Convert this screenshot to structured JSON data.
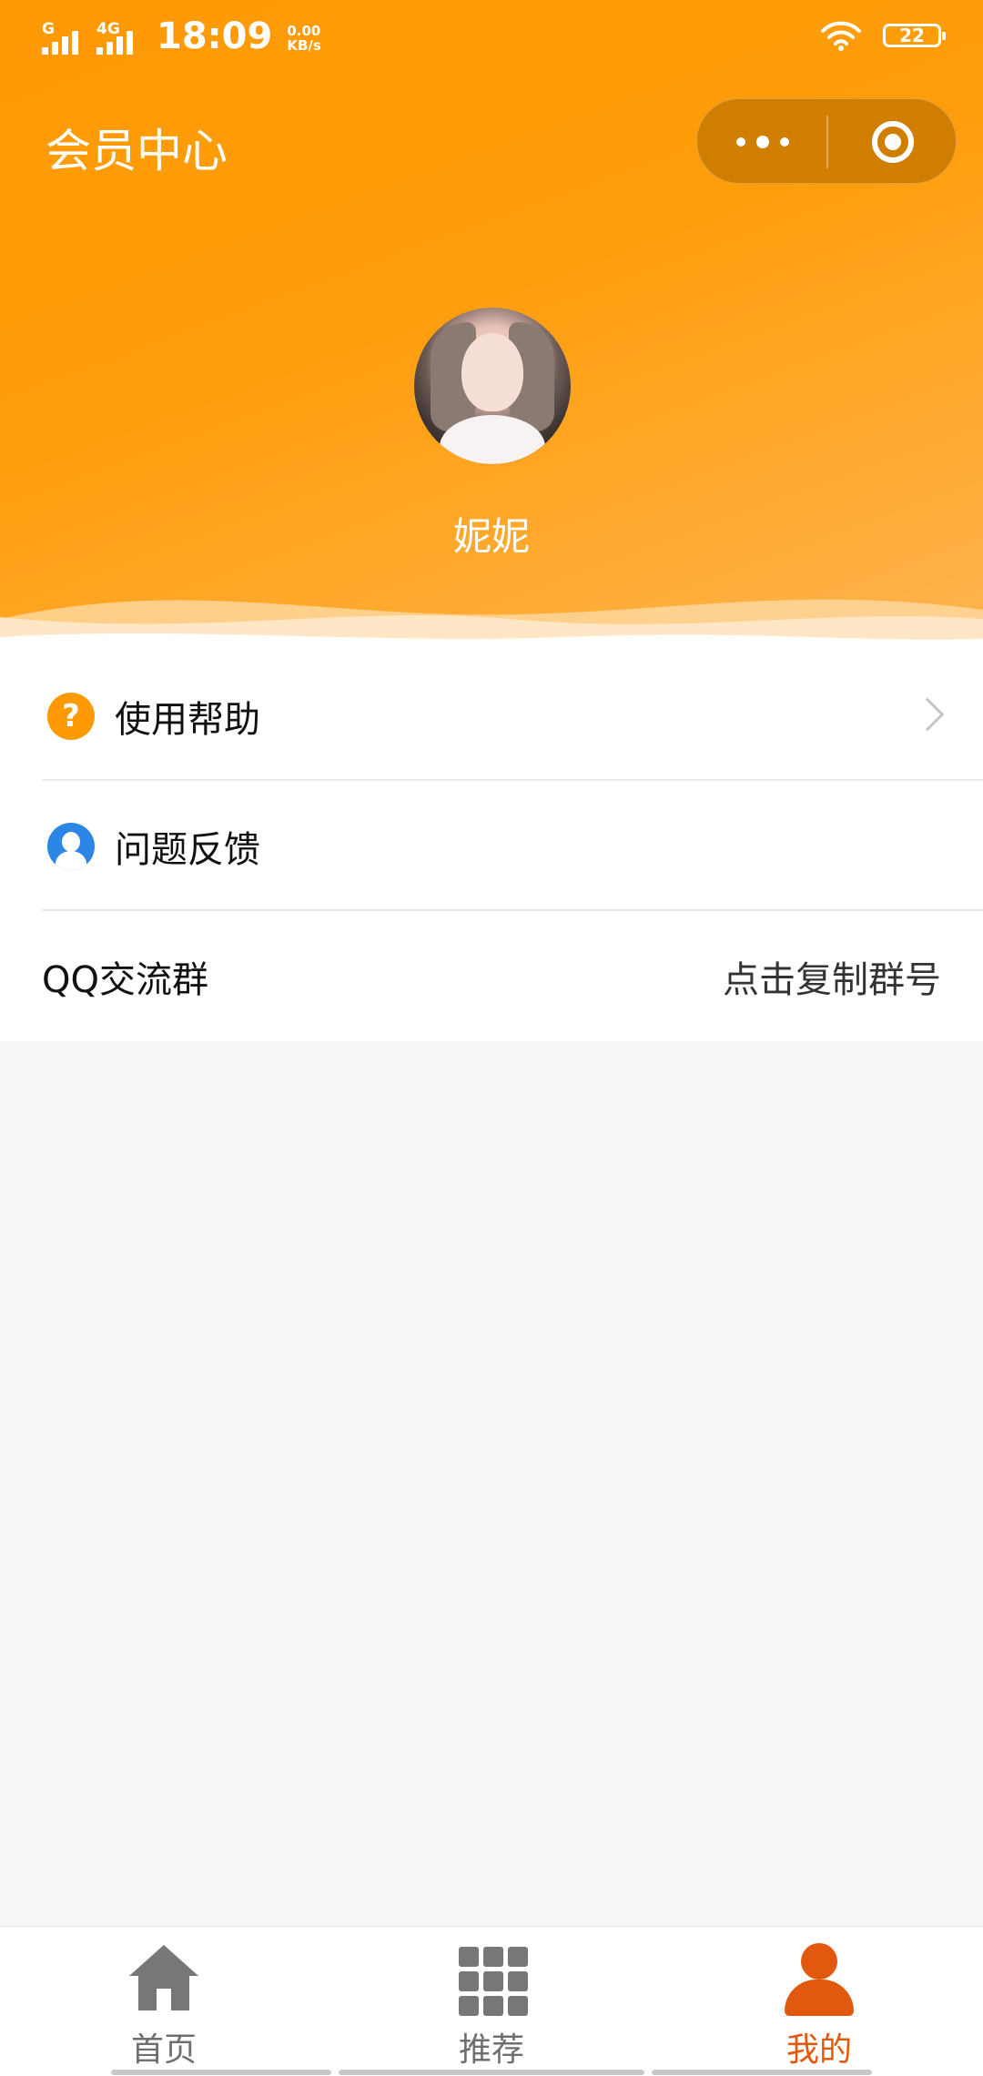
{
  "status_bar": {
    "sim1": "G",
    "sim2": "4G",
    "time": "18:09",
    "speed_value": "0.00",
    "speed_unit": "KB/s",
    "battery": "22"
  },
  "header": {
    "title": "会员中心",
    "username": "妮妮"
  },
  "menu": {
    "items": [
      {
        "label": "使用帮助",
        "icon": "help-icon"
      },
      {
        "label": "问题反馈",
        "icon": "feedback-icon"
      },
      {
        "label": "QQ交流群",
        "right_text": "点击复制群号"
      }
    ]
  },
  "tabbar": {
    "tabs": [
      {
        "label": "首页",
        "icon": "home-icon",
        "active": false
      },
      {
        "label": "推荐",
        "icon": "grid-icon",
        "active": false
      },
      {
        "label": "我的",
        "icon": "person-icon",
        "active": true
      }
    ]
  },
  "colors": {
    "header_orange": "#ff9a05",
    "active_tab": "#e3580f",
    "capsule": "#cf7e00",
    "help_icon": "#ff9a05",
    "feedback_icon": "#2b86e6"
  }
}
